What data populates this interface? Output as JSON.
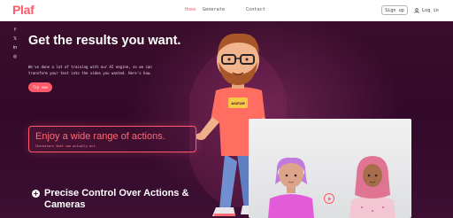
{
  "app": {
    "logo": "Plaf"
  },
  "nav": {
    "items": [
      {
        "label": "Home",
        "active": true
      },
      {
        "label": "Generate",
        "active": false
      },
      {
        "label": "Contact",
        "active": false
      }
    ]
  },
  "auth": {
    "signup_label": "Sign up",
    "login_label": "Log in"
  },
  "social": {
    "icons": [
      "facebook-icon",
      "x-icon",
      "linkedin-icon",
      "instagram-icon"
    ]
  },
  "hero": {
    "title": "Get the results you want.",
    "subtitle": "We've done a lot of training with our AI engine, so we can transform your text into the video you wanted. Here's how.",
    "cta_label": "Try now"
  },
  "features": {
    "card_title": "Enjoy a wide range of actions.",
    "card_subtitle": "Characters that can actually act.",
    "second_title": "Precise Control Over Actions & Cameras"
  },
  "colors": {
    "accent": "#ff5a6a",
    "background": "#3b0f2a",
    "topbar": "#ffffff"
  }
}
